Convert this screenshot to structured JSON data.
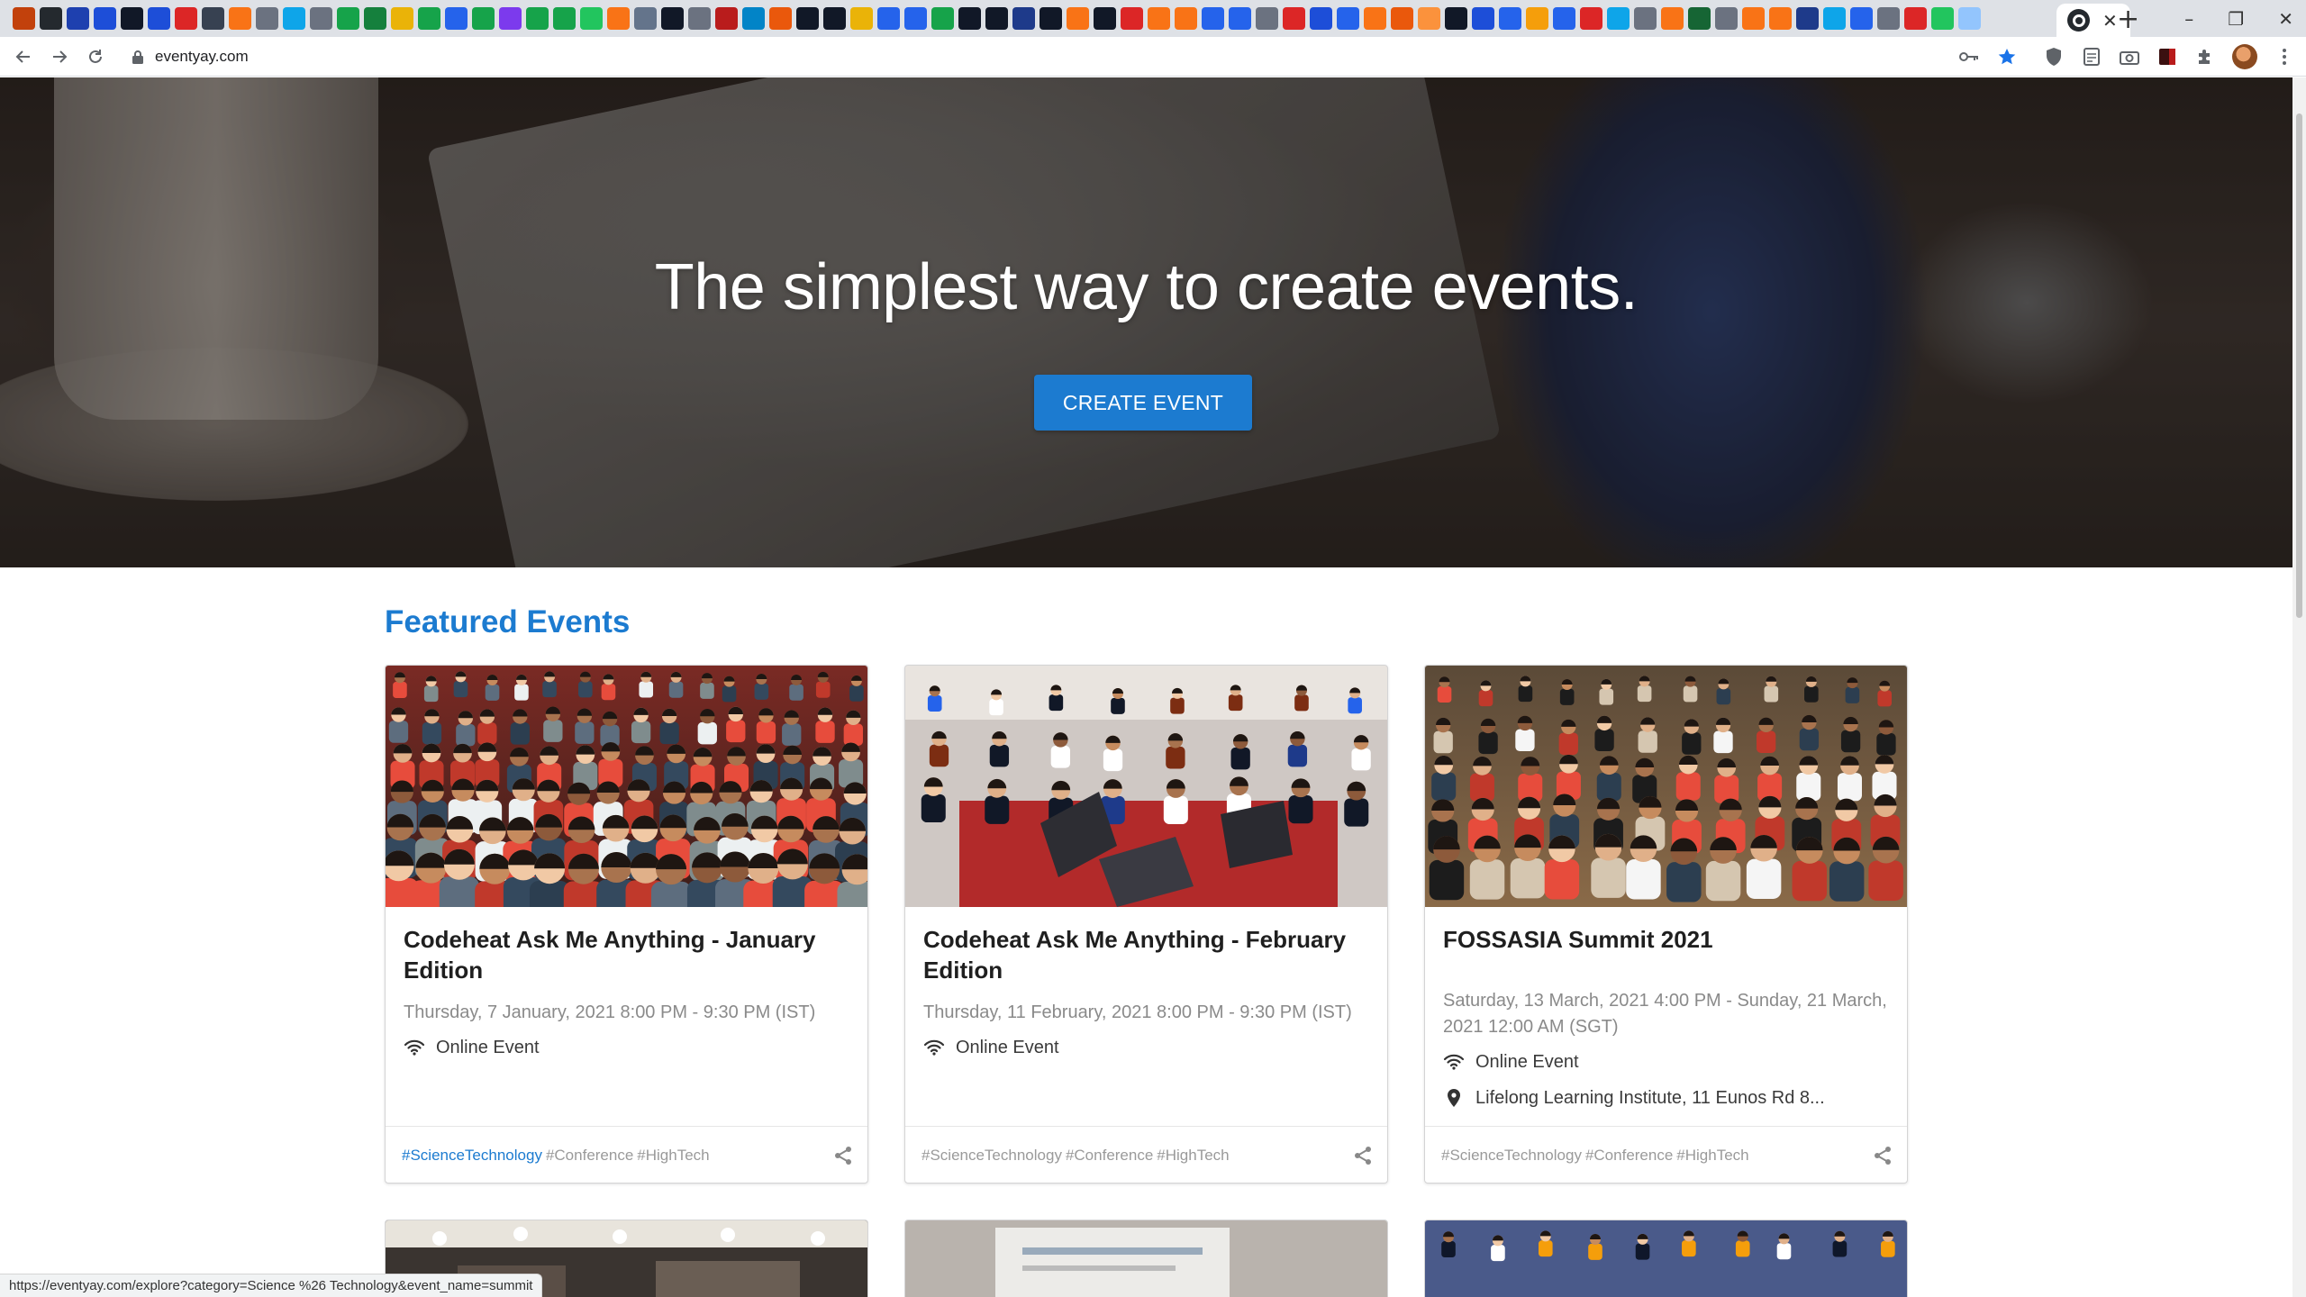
{
  "browser": {
    "tab_title_icon": "github-icon",
    "tab_close_label": "✕",
    "new_tab_label": "+",
    "url": "eventyay.com",
    "window_controls": [
      "–",
      "❐",
      "✕"
    ],
    "favicon_colors": [
      "#c2410c",
      "#24292e",
      "#1e40af",
      "#1d4ed8",
      "#111827",
      "#1d4ed8",
      "#dc2626",
      "#374151",
      "#f97316",
      "#6b7280",
      "#0ea5e9",
      "#6b7280",
      "#16a34a",
      "#15803d",
      "#eab308",
      "#16a34a",
      "#2563eb",
      "#16a34a",
      "#7c3aed",
      "#16a34a",
      "#16a34a",
      "#22c55e",
      "#f97316",
      "#64748b",
      "#111827",
      "#6b7280",
      "#b91c1c",
      "#0284c7",
      "#ea580c",
      "#111827",
      "#111827",
      "#eab308",
      "#2563eb",
      "#2563eb",
      "#16a34a",
      "#111827",
      "#111827",
      "#1e3a8a",
      "#111827",
      "#f97316",
      "#111827",
      "#dc2626",
      "#f97316",
      "#f97316",
      "#2563eb",
      "#2563eb",
      "#6b7280",
      "#dc2626",
      "#1d4ed8",
      "#2563eb",
      "#f97316",
      "#ea580c",
      "#fb923c",
      "#111827",
      "#1d4ed8",
      "#2563eb",
      "#f59e0b",
      "#2563eb",
      "#dc2626",
      "#0ea5e9",
      "#6b7280",
      "#f97316",
      "#166534",
      "#6b7280",
      "#f97316",
      "#f97316",
      "#1e3a8a",
      "#0ea5e9",
      "#2563eb",
      "#6b7280",
      "#dc2626",
      "#22c55e",
      "#93c5fd"
    ]
  },
  "hero": {
    "title": "The simplest way to create events.",
    "cta_label": "CREATE EVENT"
  },
  "featured": {
    "title": "Featured Events",
    "events": [
      {
        "title": "Codeheat Ask Me Anything - January Edition",
        "date": "Thursday, 7 January, 2021 8:00 PM - 9:30 PM (IST)",
        "mode": "Online Event",
        "location": "",
        "tags": [
          "#ScienceTechnology",
          "#Conference",
          "#HighTech"
        ]
      },
      {
        "title": "Codeheat Ask Me Anything - February Edition",
        "date": "Thursday, 11 February, 2021 8:00 PM - 9:30 PM (IST)",
        "mode": "Online Event",
        "location": "",
        "tags": [
          "#ScienceTechnology",
          "#Conference",
          "#HighTech"
        ]
      },
      {
        "title": "FOSSASIA Summit 2021",
        "date": "Saturday, 13 March, 2021 4:00 PM - Sunday, 21 March, 2021 12:00 AM (SGT)",
        "mode": "Online Event",
        "location": "Lifelong Learning Institute, 11 Eunos Rd 8...",
        "tags": [
          "#ScienceTechnology",
          "#Conference",
          "#HighTech"
        ]
      }
    ]
  },
  "status_bar": {
    "link_preview": "https://eventyay.com/explore?category=Science %26 Technology&event_name=summit"
  }
}
